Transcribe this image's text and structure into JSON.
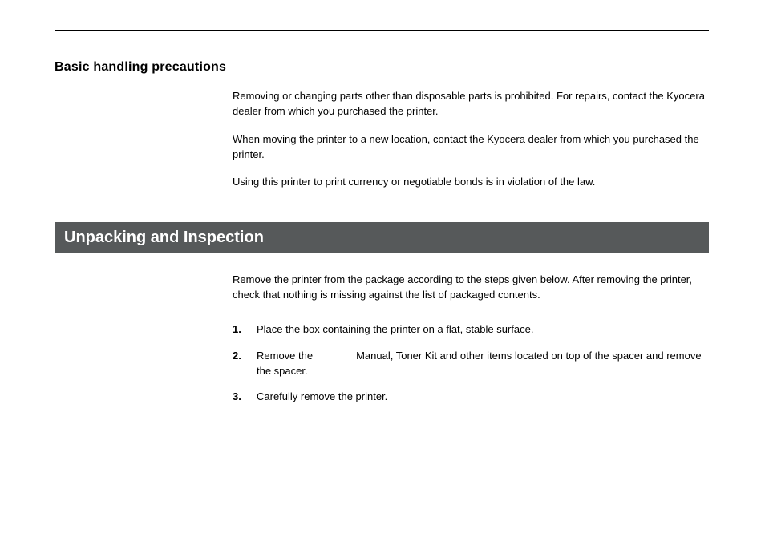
{
  "section1": {
    "heading": "Basic handling precautions",
    "paragraphs": [
      "Removing or changing parts other than disposable parts is prohibited.  For repairs, contact the Kyocera dealer from which you purchased the printer.",
      "When moving the printer to a new location, contact the Kyocera dealer from which you purchased the printer.",
      "Using this printer to print currency or negotiable bonds is in violation of the law."
    ]
  },
  "banner_title": "Unpacking and Inspection",
  "intro": "Remove the printer from the package according to the steps given below. After removing the printer, check that nothing is missing against the list of packaged contents.",
  "steps": [
    {
      "num": "1.",
      "text": "Place the box containing the printer on a flat, stable surface."
    },
    {
      "num": "2.",
      "text_a": "Remove the",
      "text_b": "Manual, Toner Kit and other items located on top of the spacer and remove the spacer."
    },
    {
      "num": "3.",
      "text": "Carefully remove the printer."
    }
  ]
}
